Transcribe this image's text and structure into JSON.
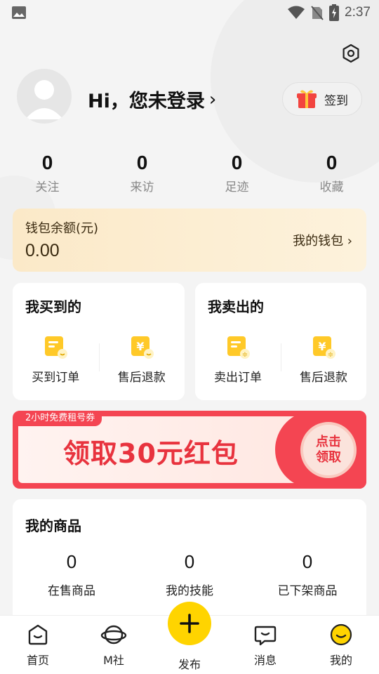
{
  "status_bar": {
    "time": "2:37",
    "icons": [
      "image-icon",
      "wifi-icon",
      "no-sim-icon",
      "battery-charging-icon"
    ]
  },
  "header": {
    "settings_icon": "settings-icon",
    "login_title": "Hi，您未登录",
    "chevron": "›",
    "checkin_label": "签到",
    "checkin_icon": "gift-icon"
  },
  "stats": [
    {
      "value": "0",
      "label": "关注"
    },
    {
      "value": "0",
      "label": "来访"
    },
    {
      "value": "0",
      "label": "足迹"
    },
    {
      "value": "0",
      "label": "收藏"
    }
  ],
  "wallet": {
    "title": "钱包余额(元)",
    "amount": "0.00",
    "link_label": "我的钱包 ›"
  },
  "bought": {
    "title": "我买到的",
    "items": [
      {
        "label": "买到订单",
        "icon": "order-icon"
      },
      {
        "label": "售后退款",
        "icon": "refund-icon"
      }
    ]
  },
  "sold": {
    "title": "我卖出的",
    "items": [
      {
        "label": "卖出订单",
        "icon": "order-icon"
      },
      {
        "label": "售后退款",
        "icon": "refund-icon"
      }
    ]
  },
  "banner": {
    "tag": "2小时免费租号券",
    "headline": "领取30元红包",
    "claim_line1": "点击",
    "claim_line2": "领取"
  },
  "goods": {
    "title": "我的商品",
    "items": [
      {
        "value": "0",
        "label": "在售商品"
      },
      {
        "value": "0",
        "label": "我的技能"
      },
      {
        "value": "0",
        "label": "已下架商品"
      }
    ]
  },
  "nav": {
    "items": [
      {
        "label": "首页",
        "icon": "home-icon"
      },
      {
        "label": "M社",
        "icon": "planet-icon"
      },
      {
        "label": "发布",
        "icon": "plus-icon"
      },
      {
        "label": "消息",
        "icon": "message-icon"
      },
      {
        "label": "我的",
        "icon": "smiley-icon"
      }
    ]
  },
  "colors": {
    "accent_yellow": "#ffd400",
    "banner_red": "#f44552",
    "wallet_bg": "#fbe9c8"
  }
}
